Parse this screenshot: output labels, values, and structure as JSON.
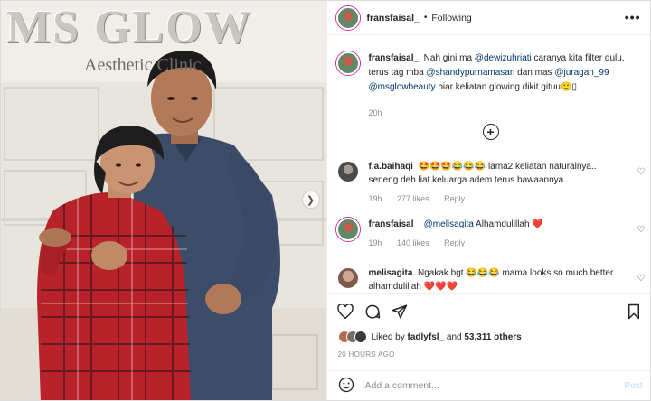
{
  "photo": {
    "sign_title": "MS GLOW",
    "sign_subtitle": "Aesthetic Clinic",
    "next_icon": "chevron-right-icon"
  },
  "header": {
    "username": "fransfaisal_",
    "separator": "•",
    "follow_status": "Following",
    "more_icon": "more-icon"
  },
  "caption": {
    "username": "fransfaisal_",
    "segments": [
      {
        "text": "Nah gini ma ",
        "type": "text"
      },
      {
        "text": "@dewizuhriati",
        "type": "mention"
      },
      {
        "text": " caranya kita filter dulu, terus tag mba ",
        "type": "text"
      },
      {
        "text": "@shandypurnamasari",
        "type": "mention"
      },
      {
        "text": " dan mas ",
        "type": "text"
      },
      {
        "text": "@juragan_99",
        "type": "mention"
      },
      {
        "text": " ",
        "type": "text"
      },
      {
        "text": "@msglowbeauty",
        "type": "mention"
      },
      {
        "text": " biar keliatan glowing dikit gituu🙂▯",
        "type": "text"
      }
    ],
    "time": "20h"
  },
  "load_more_icon": "plus-circle-icon",
  "comments": [
    {
      "username": "f.a.baihaqi",
      "text": "🤩🤩🤩😂😂😂 lama2 keliatan naturalnya.. seneng deh liat keluarga adem terus bawaannya...",
      "time": "19h",
      "likes": "277 likes",
      "reply": "Reply"
    },
    {
      "username": "fransfaisal_",
      "mention": "@melisagita",
      "text": " Alhamdulillah ❤️",
      "time": "19h",
      "likes": "140 likes",
      "reply": "Reply"
    },
    {
      "username": "melisagita",
      "text": "Ngakak bgt 😂😂😂 mama looks so much better alhamdulillah ❤️❤️❤️"
    }
  ],
  "likes": {
    "prefix": "Liked by ",
    "user": "fadlyfsl_",
    "middle": " and ",
    "count": "53,311 others"
  },
  "posted_ago": "20 HOURS AGO",
  "add_comment": {
    "placeholder": "Add a comment...",
    "post_label": "Post"
  },
  "colors": {
    "mention": "#00376b",
    "secondary_text": "#8e8e8e",
    "post_disabled": "#b2dffc",
    "heart": "#ed4956"
  }
}
